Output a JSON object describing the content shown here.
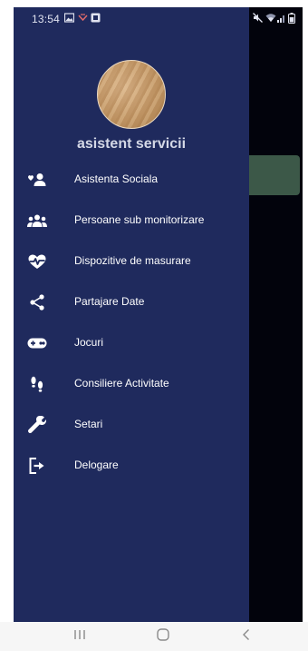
{
  "status_bar": {
    "time": "13:54",
    "left_icons": [
      "gallery-icon",
      "notification-icon",
      "app-icon"
    ],
    "right_icons": [
      "mute-icon",
      "wifi-icon",
      "signal-icon",
      "battery-icon"
    ]
  },
  "drawer": {
    "user_name": "asistent servicii",
    "menu": [
      {
        "label": "Asistenta Sociala",
        "icon": "person-heart-icon"
      },
      {
        "label": "Persoane sub monitorizare",
        "icon": "group-icon"
      },
      {
        "label": "Dispozitive de masurare",
        "icon": "heartbeat-icon"
      },
      {
        "label": "Partajare Date",
        "icon": "share-icon"
      },
      {
        "label": "Jocuri",
        "icon": "gamepad-icon"
      },
      {
        "label": "Consiliere Activitate",
        "icon": "footsteps-icon"
      },
      {
        "label": "Setari",
        "icon": "wrench-icon"
      },
      {
        "label": "Delogare",
        "icon": "logout-icon"
      }
    ]
  },
  "nav_bar": {
    "buttons": [
      "recents-button",
      "home-button",
      "back-button"
    ]
  },
  "colors": {
    "drawer_bg": "#1f2a5d",
    "overlay_bg": "#02030c",
    "text": "#ffffff"
  }
}
